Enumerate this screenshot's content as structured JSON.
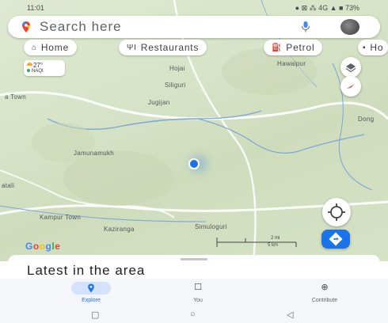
{
  "status_bar": {
    "time": "11:01",
    "indicators": "● ⊠ ⁂ 4G ▲ ■ 73%"
  },
  "search": {
    "placeholder": "Search here",
    "pin_icon": "maps-pin-icon",
    "mic_icon": "mic-icon",
    "avatar_icon": "profile-avatar"
  },
  "chips": [
    {
      "label": "Home",
      "icon": "⌂"
    },
    {
      "label": "Restaurants",
      "icon": "ΨΙ"
    },
    {
      "label": "Petrol",
      "icon": "⛽"
    },
    {
      "label": "Ho",
      "icon": "▪"
    }
  ],
  "weather": {
    "temp": "27°",
    "aqi": "NAQI"
  },
  "map_labels": {
    "hojai": "Hojai",
    "hawaipur": "Hawaipur",
    "siliguri": "Siliguri",
    "a_town": "a Town",
    "jugijan": "Jugijan",
    "dong": "Dong",
    "jamunamukh": "Jamunamukh",
    "atali": "atali",
    "kampur_town": "Kampur Town",
    "kaziranga": "Kaziranga",
    "simuloguri": "Simuloguri"
  },
  "scale": {
    "miles": "2 mi",
    "km": "5 km"
  },
  "google_logo": {
    "letters": [
      "G",
      "o",
      "o",
      "g",
      "l",
      "e"
    ],
    "colors": [
      "#4285f4",
      "#ea4335",
      "#fbbc05",
      "#4285f4",
      "#34a853",
      "#ea4335"
    ]
  },
  "sheet": {
    "title": "Latest in the area"
  },
  "nav": [
    {
      "label": "Explore",
      "glyph": "●"
    },
    {
      "label": "You",
      "glyph": "☐"
    },
    {
      "label": "Contribute",
      "glyph": "⊕"
    }
  ],
  "system_nav": {
    "recents": "▢",
    "home": "○",
    "back": "◁"
  },
  "colors": {
    "accent": "#1a73e8",
    "explore_pill": "#d3e3fd"
  }
}
